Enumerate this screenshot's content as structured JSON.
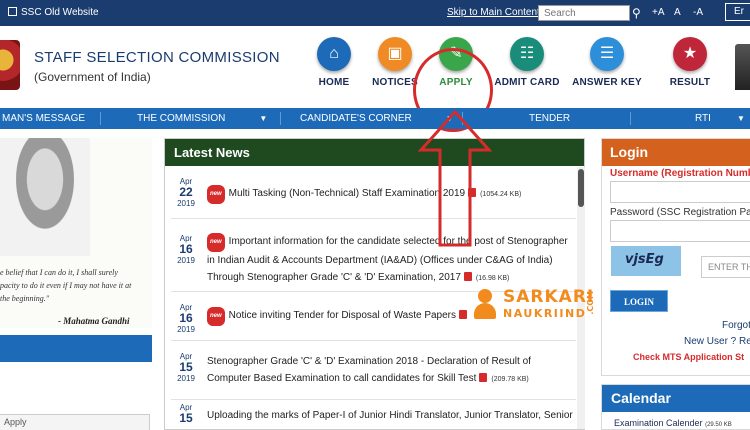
{
  "topbar": {
    "old_website": "SSC Old Website",
    "skip": "Skip to Main Content",
    "search_placeholder": "Search",
    "font_plus": "+A",
    "font_normal": "A",
    "font_minus": "-A",
    "lang": "Er"
  },
  "header": {
    "title": "STAFF SELECTION COMMISSION",
    "subtitle": "(Government of India)"
  },
  "nav_icons": [
    {
      "label": "HOME",
      "icon": "home-icon",
      "color": "#1d6bb8"
    },
    {
      "label": "NOTICES",
      "icon": "notice-icon",
      "color": "#f08a24"
    },
    {
      "label": "APPLY",
      "icon": "edit-icon",
      "color": "#3aa64a"
    },
    {
      "label": "ADMIT CARD",
      "icon": "id-card-icon",
      "color": "#1a8c7a"
    },
    {
      "label": "ANSWER KEY",
      "icon": "key-icon",
      "color": "#2d8fd9"
    },
    {
      "label": "RESULT",
      "icon": "trophy-icon",
      "color": "#c0263a"
    }
  ],
  "main_nav": [
    {
      "label": "MAN'S MESSAGE",
      "caret": false
    },
    {
      "label": "THE COMMISSION",
      "caret": true
    },
    {
      "label": "CANDIDATE'S CORNER",
      "caret": true
    },
    {
      "label": "TENDER",
      "caret": false
    },
    {
      "label": "RTI",
      "caret": true
    }
  ],
  "quote": {
    "text": "e belief that I can do it, I shall surely\npacity to do it even if I may not have it at\nthe beginning.\"",
    "author": "- Mahatma Gandhi"
  },
  "news": {
    "title": "Latest News",
    "items": [
      {
        "month": "Apr",
        "day": "22",
        "year": "2019",
        "new": true,
        "text": "Multi Tasking (Non-Technical) Staff Examination 2019",
        "size": "(1054.24 KB)"
      },
      {
        "month": "Apr",
        "day": "16",
        "year": "2019",
        "new": true,
        "text": "Important information for the candidate selected for the post of Stenographer in Indian Audit & Accounts Department (IA&AD) (Offices under C&AG of India) Through Stenographer Grade 'C' & 'D' Examination, 2017",
        "size": "(16.98 KB)"
      },
      {
        "month": "Apr",
        "day": "16",
        "year": "2019",
        "new": true,
        "text": "Notice inviting Tender for Disposal of Waste Papers",
        "size": ""
      },
      {
        "month": "Apr",
        "day": "15",
        "year": "2019",
        "new": false,
        "text": "Stenographer Grade 'C' & 'D' Examination 2018 - Declaration of Result of Computer Based Examination to call candidates for Skill Test",
        "size": "(209.78 KB)"
      },
      {
        "month": "Apr",
        "day": "15",
        "year": "",
        "new": false,
        "text": "Uploading the marks of Paper-I of Junior Hindi Translator, Junior Translator, Senior",
        "size": ""
      }
    ],
    "new_badge": "new"
  },
  "watermark": {
    "line1": "SARKARI",
    "line2": "NAUKRIIND",
    "line3": ".COM"
  },
  "login": {
    "title": "Login",
    "username_label": "Username (Registration Numb",
    "password_label": "Password (SSC Registration Pa",
    "captcha": "vjsEg",
    "captcha_placeholder": "ENTER TH",
    "login_button": "LOGIN",
    "forgot": "Forgot",
    "new_user": "New User ? Reg",
    "check_mts": "Check MTS Application St"
  },
  "calendar": {
    "title": "Calendar",
    "row": "Examination Calender",
    "size": "(29.50 KB"
  },
  "status_bar": "Apply"
}
